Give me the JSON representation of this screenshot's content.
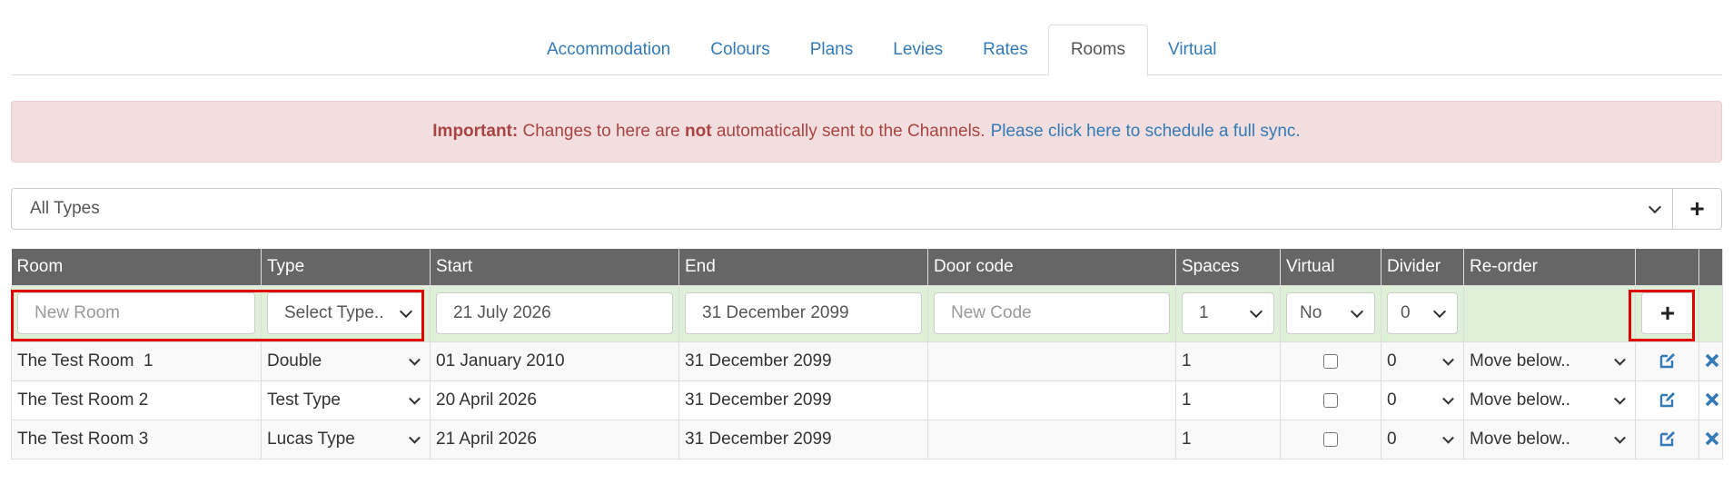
{
  "tabs": [
    {
      "label": "Accommodation",
      "active": false
    },
    {
      "label": "Colours",
      "active": false
    },
    {
      "label": "Plans",
      "active": false
    },
    {
      "label": "Levies",
      "active": false
    },
    {
      "label": "Rates",
      "active": false
    },
    {
      "label": "Rooms",
      "active": true
    },
    {
      "label": "Virtual",
      "active": false
    }
  ],
  "alert": {
    "strong": "Important:",
    "text1": "Changes to here are",
    "emph": "not",
    "text2": "automatically sent to the Channels.",
    "link": "Please click here to schedule a full sync."
  },
  "filter": {
    "selected": "All Types",
    "add_icon": "plus-icon"
  },
  "table": {
    "headers": [
      "Room",
      "Type",
      "Start",
      "End",
      "Door code",
      "Spaces",
      "Virtual",
      "Divider",
      "Re-order",
      "",
      ""
    ],
    "new_row": {
      "room_placeholder": "New Room",
      "type_selected": "Select Type..",
      "start": "21 July 2026",
      "end": "31 December 2099",
      "code_placeholder": "New Code",
      "spaces": "1",
      "virtual": "No",
      "divider": "0",
      "add_icon": "plus-icon"
    },
    "rows": [
      {
        "room": "The Test Room  1",
        "type": "Double",
        "start": "01 January 2010",
        "end": "31 December 2099",
        "door_code": "",
        "spaces": "1",
        "virtual": false,
        "divider": "0",
        "reorder": "Move below.."
      },
      {
        "room": "The Test Room 2",
        "type": "Test Type",
        "start": "20 April 2026",
        "end": "31 December 2099",
        "door_code": "",
        "spaces": "1",
        "virtual": false,
        "divider": "0",
        "reorder": "Move below.."
      },
      {
        "room": "The Test Room 3",
        "type": "Lucas Type",
        "start": "21 April 2026",
        "end": "31 December 2099",
        "door_code": "",
        "spaces": "1",
        "virtual": false,
        "divider": "0",
        "reorder": "Move below.."
      }
    ]
  },
  "colors": {
    "link": "#337ab7",
    "header_bg": "#666666",
    "new_row_bg": "#dff0d8",
    "alert_bg": "#f2dede",
    "alert_text": "#a94442",
    "highlight": "#e00000"
  }
}
